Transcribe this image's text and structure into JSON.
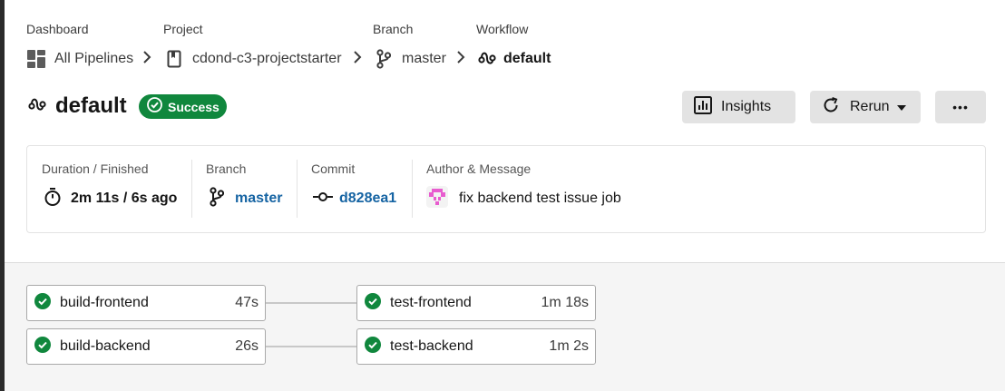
{
  "breadcrumbs": [
    {
      "label": "Dashboard",
      "value": "All Pipelines",
      "icon": "dashboard-icon"
    },
    {
      "label": "Project",
      "value": "cdond-c3-projectstarter",
      "icon": "bookmark-icon"
    },
    {
      "label": "Branch",
      "value": "master",
      "icon": "branch-icon"
    },
    {
      "label": "Workflow",
      "value": "default",
      "icon": "workflow-icon"
    }
  ],
  "workflow": {
    "title": "default",
    "status": "Success"
  },
  "actions": {
    "insights_label": "Insights",
    "rerun_label": "Rerun",
    "more_label": "•••"
  },
  "summary": {
    "duration_label": "Duration / Finished",
    "duration_value": "2m 11s / 6s ago",
    "branch_label": "Branch",
    "branch_value": "master",
    "commit_label": "Commit",
    "commit_value": "d828ea1",
    "author_label": "Author & Message",
    "message": "fix backend test issue job"
  },
  "jobs": [
    {
      "name": "build-frontend",
      "duration": "47s"
    },
    {
      "name": "test-frontend",
      "duration": "1m 18s"
    },
    {
      "name": "build-backend",
      "duration": "26s"
    },
    {
      "name": "test-backend",
      "duration": "1m 2s"
    }
  ],
  "colors": {
    "success": "#10873d",
    "link": "#1664a3",
    "avatar": "#e85ccf"
  }
}
